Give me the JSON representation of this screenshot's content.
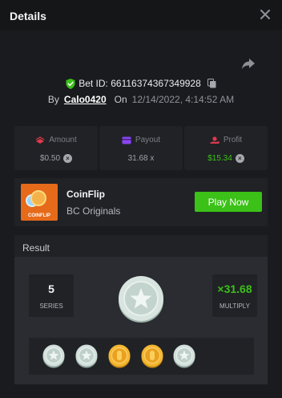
{
  "header": {
    "title": "Details"
  },
  "bet": {
    "id_label": "Bet ID: 66116374367349928",
    "by_label": "By",
    "username": "Calo0420",
    "on_label": "On",
    "datetime": "12/14/2022, 4:14:52 AM"
  },
  "stats": [
    {
      "label": "Amount",
      "value": "$0.50",
      "icon": "stack-icon",
      "has_coin": true
    },
    {
      "label": "Payout",
      "value": "31.68 x",
      "icon": "card-icon",
      "has_coin": false
    },
    {
      "label": "Profit",
      "value": "$15.34",
      "icon": "hand-coin-icon",
      "has_coin": true
    }
  ],
  "colors": {
    "accent_green": "#3bc117",
    "icon_red": "#e0394b",
    "icon_purple": "#8a45f2",
    "background": "#1a1b1e",
    "panel": "#202226"
  },
  "game": {
    "name": "CoinFlip",
    "provider": "BC Originals",
    "thumb_tag": "COINFLIP",
    "play_label": "Play Now"
  },
  "result": {
    "title": "Result",
    "series_value": "5",
    "series_label": "SERIES",
    "multiply_value": "×31.68",
    "multiply_label": "MULTIPLY",
    "main_coin": "silver",
    "coins": [
      "silver",
      "silver",
      "gold",
      "gold",
      "silver"
    ]
  }
}
